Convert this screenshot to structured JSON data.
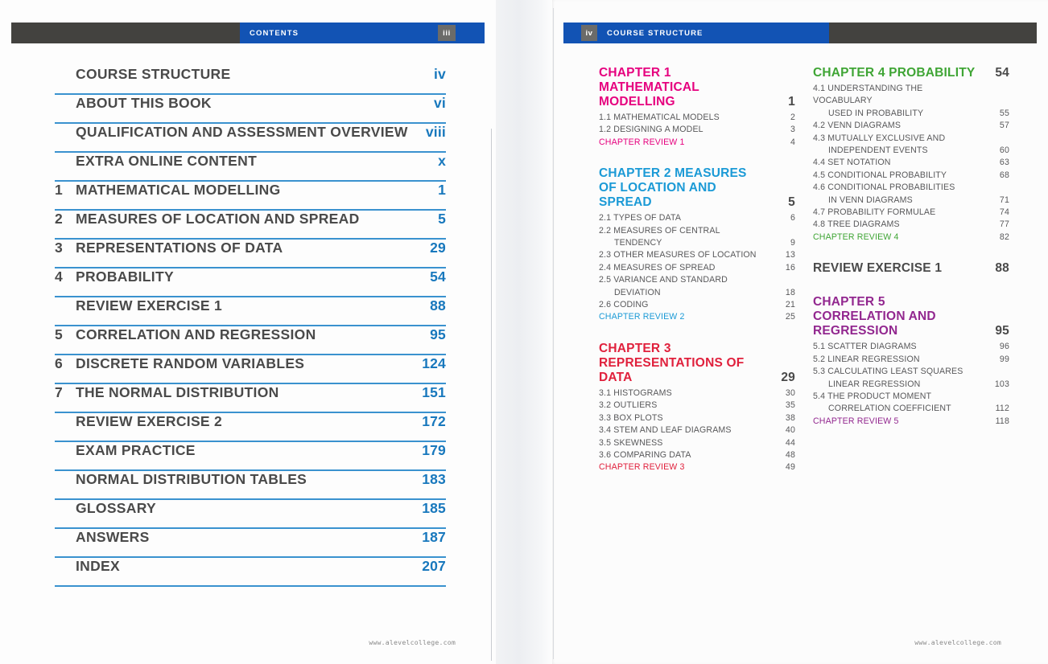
{
  "spread": {
    "left_page": {
      "running_head": {
        "title": "CONTENTS",
        "page_number": "iii"
      },
      "footer": "www.alevelcollege.com",
      "contents": [
        {
          "num": "",
          "label": "COURSE STRUCTURE",
          "page": "iv"
        },
        {
          "num": "",
          "label": "ABOUT THIS BOOK",
          "page": "vi"
        },
        {
          "num": "",
          "label": "QUALIFICATION AND ASSESSMENT OVERVIEW",
          "page": "viii"
        },
        {
          "num": "",
          "label": "EXTRA ONLINE CONTENT",
          "page": "x"
        },
        {
          "num": "1",
          "label": "MATHEMATICAL MODELLING",
          "page": "1"
        },
        {
          "num": "2",
          "label": "MEASURES OF LOCATION AND SPREAD",
          "page": "5"
        },
        {
          "num": "3",
          "label": "REPRESENTATIONS OF DATA",
          "page": "29"
        },
        {
          "num": "4",
          "label": "PROBABILITY",
          "page": "54"
        },
        {
          "num": "",
          "label": "REVIEW EXERCISE 1",
          "page": "88"
        },
        {
          "num": "5",
          "label": "CORRELATION AND REGRESSION",
          "page": "95"
        },
        {
          "num": "6",
          "label": "DISCRETE RANDOM VARIABLES",
          "page": "124"
        },
        {
          "num": "7",
          "label": "THE NORMAL DISTRIBUTION",
          "page": "151"
        },
        {
          "num": "",
          "label": "REVIEW EXERCISE 2",
          "page": "172"
        },
        {
          "num": "",
          "label": "EXAM PRACTICE",
          "page": "179"
        },
        {
          "num": "",
          "label": "NORMAL DISTRIBUTION TABLES",
          "page": "183"
        },
        {
          "num": "",
          "label": "GLOSSARY",
          "page": "185"
        },
        {
          "num": "",
          "label": "ANSWERS",
          "page": "187"
        },
        {
          "num": "",
          "label": "INDEX",
          "page": "207"
        }
      ]
    },
    "right_page": {
      "running_head": {
        "title": "COURSE STRUCTURE",
        "page_number": "iv"
      },
      "footer": "www.alevelcollege.com",
      "column_left": [
        {
          "kind": "chapter",
          "color": "#E6007E",
          "title": "CHAPTER 1 MATHEMATICAL MODELLING",
          "page": "1",
          "sections": [
            {
              "title": "1.1 MATHEMATICAL MODELS",
              "page": "2",
              "indent": false,
              "review": false
            },
            {
              "title": "1.2 DESIGNING A MODEL",
              "page": "3",
              "indent": false,
              "review": false
            },
            {
              "title": "CHAPTER REVIEW 1",
              "page": "4",
              "indent": false,
              "review": true
            }
          ]
        },
        {
          "kind": "chapter",
          "color": "#1B9AD6",
          "title": "CHAPTER 2 MEASURES OF LOCATION AND SPREAD",
          "page": "5",
          "sections": [
            {
              "title": "2.1 TYPES OF DATA",
              "page": "6",
              "indent": false,
              "review": false
            },
            {
              "title": "2.2 MEASURES OF CENTRAL",
              "page": "",
              "indent": false,
              "review": false
            },
            {
              "title": "TENDENCY",
              "page": "9",
              "indent": true,
              "review": false
            },
            {
              "title": "2.3 OTHER MEASURES OF LOCATION",
              "page": "13",
              "indent": false,
              "review": false
            },
            {
              "title": "2.4 MEASURES OF SPREAD",
              "page": "16",
              "indent": false,
              "review": false
            },
            {
              "title": "2.5 VARIANCE AND STANDARD",
              "page": "",
              "indent": false,
              "review": false
            },
            {
              "title": "DEVIATION",
              "page": "18",
              "indent": true,
              "review": false
            },
            {
              "title": "2.6 CODING",
              "page": "21",
              "indent": false,
              "review": false
            },
            {
              "title": "CHAPTER REVIEW 2",
              "page": "25",
              "indent": false,
              "review": true
            }
          ]
        },
        {
          "kind": "chapter",
          "color": "#E0203C",
          "title": "CHAPTER 3 REPRESENTATIONS OF DATA",
          "page": "29",
          "sections": [
            {
              "title": "3.1 HISTOGRAMS",
              "page": "30",
              "indent": false,
              "review": false
            },
            {
              "title": "3.2 OUTLIERS",
              "page": "35",
              "indent": false,
              "review": false
            },
            {
              "title": "3.3 BOX PLOTS",
              "page": "38",
              "indent": false,
              "review": false
            },
            {
              "title": "3.4 STEM AND LEAF DIAGRAMS",
              "page": "40",
              "indent": false,
              "review": false
            },
            {
              "title": "3.5 SKEWNESS",
              "page": "44",
              "indent": false,
              "review": false
            },
            {
              "title": "3.6 COMPARING DATA",
              "page": "48",
              "indent": false,
              "review": false
            },
            {
              "title": "CHAPTER REVIEW 3",
              "page": "49",
              "indent": false,
              "review": true
            }
          ]
        }
      ],
      "column_right": [
        {
          "kind": "chapter",
          "color": "#3FA535",
          "title": "CHAPTER 4 PROBABILITY",
          "page": "54",
          "sections": [
            {
              "title": "4.1 UNDERSTANDING THE VOCABULARY",
              "page": "",
              "indent": false,
              "review": false
            },
            {
              "title": "USED IN PROBABILITY",
              "page": "55",
              "indent": true,
              "review": false
            },
            {
              "title": "4.2 VENN DIAGRAMS",
              "page": "57",
              "indent": false,
              "review": false
            },
            {
              "title": "4.3 MUTUALLY EXCLUSIVE AND",
              "page": "",
              "indent": false,
              "review": false
            },
            {
              "title": "INDEPENDENT EVENTS",
              "page": "60",
              "indent": true,
              "review": false
            },
            {
              "title": "4.4 SET NOTATION",
              "page": "63",
              "indent": false,
              "review": false
            },
            {
              "title": "4.5 CONDITIONAL PROBABILITY",
              "page": "68",
              "indent": false,
              "review": false
            },
            {
              "title": "4.6 CONDITIONAL PROBABILITIES",
              "page": "",
              "indent": false,
              "review": false
            },
            {
              "title": "IN VENN DIAGRAMS",
              "page": "71",
              "indent": true,
              "review": false
            },
            {
              "title": "4.7 PROBABILITY FORMULAE",
              "page": "74",
              "indent": false,
              "review": false
            },
            {
              "title": "4.8 TREE DIAGRAMS",
              "page": "77",
              "indent": false,
              "review": false
            },
            {
              "title": "CHAPTER REVIEW 4",
              "page": "82",
              "indent": false,
              "review": true
            }
          ]
        },
        {
          "kind": "review_exercise",
          "title": "REVIEW EXERCISE 1",
          "page": "88"
        },
        {
          "kind": "chapter",
          "color": "#92278F",
          "title": "CHAPTER 5 CORRELATION AND REGRESSION",
          "page": "95",
          "sections": [
            {
              "title": "5.1 SCATTER DIAGRAMS",
              "page": "96",
              "indent": false,
              "review": false
            },
            {
              "title": "5.2 LINEAR REGRESSION",
              "page": "99",
              "indent": false,
              "review": false
            },
            {
              "title": "5.3 CALCULATING LEAST SQUARES",
              "page": "",
              "indent": false,
              "review": false
            },
            {
              "title": "LINEAR REGRESSION",
              "page": "103",
              "indent": true,
              "review": false
            },
            {
              "title": "5.4 THE PRODUCT MOMENT",
              "page": "",
              "indent": false,
              "review": false
            },
            {
              "title": "CORRELATION COEFFICIENT",
              "page": "112",
              "indent": true,
              "review": false
            },
            {
              "title": "CHAPTER REVIEW 5",
              "page": "118",
              "indent": false,
              "review": true
            }
          ]
        }
      ]
    }
  }
}
